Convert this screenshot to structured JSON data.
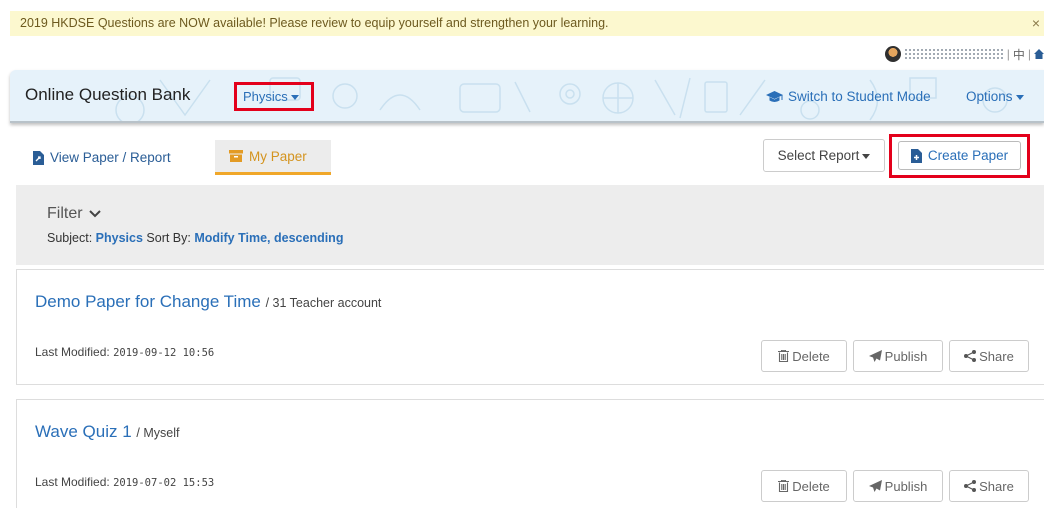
{
  "announcement": {
    "text": "2019 HKDSE Questions are NOW available! Please review to equip yourself and strengthen your learning.",
    "close": "×"
  },
  "userbar": {
    "lang": "中",
    "sep": "|"
  },
  "header": {
    "title": "Online Question Bank",
    "subject": "Physics",
    "switch_mode": "Switch to Student Mode",
    "options": "Options"
  },
  "tabs": [
    {
      "label": "View Paper / Report"
    },
    {
      "label": "My Paper"
    }
  ],
  "toolbar": {
    "select_report": "Select Report",
    "create_paper": "Create Paper"
  },
  "filter": {
    "label": "Filter",
    "subject_label": "Subject:",
    "subject_value": "Physics",
    "sort_label": "Sort By:",
    "sort_value": "Modify Time, descending"
  },
  "papers": [
    {
      "title": "Demo Paper for Change Time",
      "owner": "/ 31 Teacher account",
      "modified_label": "Last Modified:",
      "modified": "2019-09-12 10:56"
    },
    {
      "title": "Wave Quiz 1",
      "owner": "/ Myself",
      "modified_label": "Last Modified:",
      "modified": "2019-07-02 15:53"
    }
  ],
  "actions": {
    "delete": "Delete",
    "publish": "Publish",
    "share": "Share"
  },
  "colors": {
    "link": "#2a6fb8",
    "highlight": "#e3001b",
    "active_tab": "#f0a72a",
    "banner": "#fcf8cf"
  }
}
